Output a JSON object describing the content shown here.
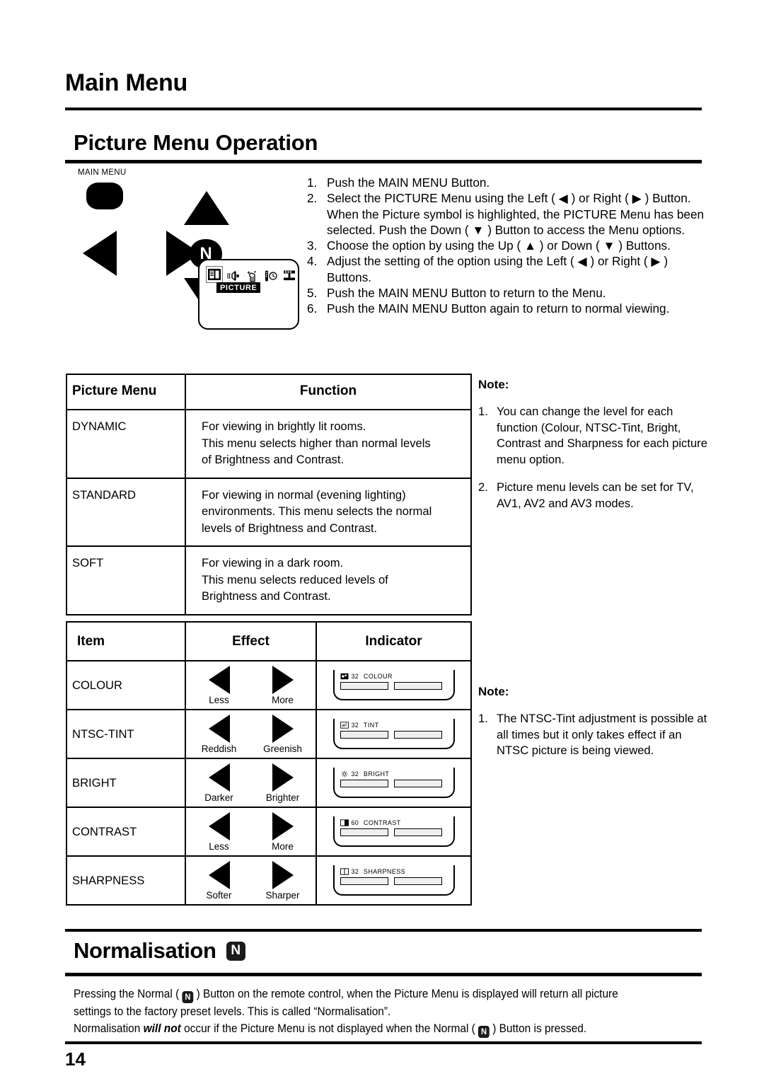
{
  "headings": {
    "main": "Main Menu",
    "sub": "Picture Menu Operation",
    "normalisation": "Normalisation"
  },
  "remote": {
    "main_menu_label": "MAIN MENU",
    "normal_button_letter": "N",
    "osd_selected_menu": "PICTURE",
    "menu_icons": [
      "picture-icon",
      "audio-icon",
      "features-icon",
      "timer-icon",
      "setup-icon"
    ]
  },
  "steps": [
    {
      "n": "1.",
      "text": "Push the MAIN MENU Button."
    },
    {
      "n": "2.",
      "text": "Select the PICTURE Menu using the Left ( ◀ ) or Right ( ▶ ) Button. When the Picture symbol is highlighted, the PICTURE Menu has been selected. Push the Down ( ▼ ) Button to access the Menu options."
    },
    {
      "n": "3.",
      "text": "Choose the option by using the Up ( ▲ ) or Down ( ▼ ) Buttons."
    },
    {
      "n": "4.",
      "text": "Adjust the setting of the option using the Left ( ◀ ) or Right ( ▶ ) Buttons."
    },
    {
      "n": "5.",
      "text": "Push the MAIN MENU Button to return to the Menu."
    },
    {
      "n": "6.",
      "text": "Push the MAIN MENU Button again to return to normal viewing."
    }
  ],
  "table_menu": {
    "headers": [
      "Picture Menu",
      "Function"
    ],
    "rows": [
      {
        "menu": "DYNAMIC",
        "function": "For viewing in brightly lit rooms.\nThis menu selects higher than normal levels\nof Brightness and Contrast."
      },
      {
        "menu": "STANDARD",
        "function": "For viewing in normal (evening lighting)\nenvironments. This menu selects the normal\nlevels of Brightness and Contrast."
      },
      {
        "menu": "SOFT",
        "function": "For viewing in a dark room.\nThis menu selects reduced levels of\nBrightness and Contrast."
      }
    ]
  },
  "table_item": {
    "headers": [
      "Item",
      "Effect",
      "Indicator"
    ],
    "rows": [
      {
        "item": "COLOUR",
        "left_label": "Less",
        "right_label": "More",
        "ind_value": "32",
        "ind_name": "COLOUR",
        "ind_icon": "colour-icon"
      },
      {
        "item": "NTSC-TINT",
        "left_label": "Reddish",
        "right_label": "Greenish",
        "ind_value": "32",
        "ind_name": "TINT",
        "ind_icon": "tint-icon"
      },
      {
        "item": "BRIGHT",
        "left_label": "Darker",
        "right_label": "Brighter",
        "ind_value": "32",
        "ind_name": "BRIGHT",
        "ind_icon": "brightness-icon"
      },
      {
        "item": "CONTRAST",
        "left_label": "Less",
        "right_label": "More",
        "ind_value": "60",
        "ind_name": "CONTRAST",
        "ind_icon": "contrast-icon"
      },
      {
        "item": "SHARPNESS",
        "left_label": "Softer",
        "right_label": "Sharper",
        "ind_value": "32",
        "ind_name": "SHARPNESS",
        "ind_icon": "sharpness-icon"
      }
    ]
  },
  "note_1": {
    "title": "Note:",
    "items": [
      {
        "n": "1.",
        "text": "You can change the level for each function (Colour, NTSC-Tint, Bright, Contrast and Sharpness for each picture menu option."
      },
      {
        "n": "2.",
        "text": "Picture menu levels can be set for TV, AV1, AV2 and AV3 modes."
      }
    ]
  },
  "note_2": {
    "title": "Note:",
    "items": [
      {
        "n": "1.",
        "text": "The NTSC-Tint adjustment is possible at all times but it only takes effect if an NTSC picture is being viewed."
      }
    ]
  },
  "normalisation": {
    "line1_a": "Pressing the Normal ( ",
    "line1_b": " ) Button on the remote control, when the Picture Menu is displayed will return all picture settings to the factory preset levels. This is called “Normalisation”.",
    "line2_a": "Normalisation ",
    "line2_em": "will not",
    "line2_b": " occur if the Picture Menu is not displayed when the Normal ( ",
    "line2_c": " ) Button is pressed.",
    "button_letter": "N"
  },
  "page_number": "14"
}
